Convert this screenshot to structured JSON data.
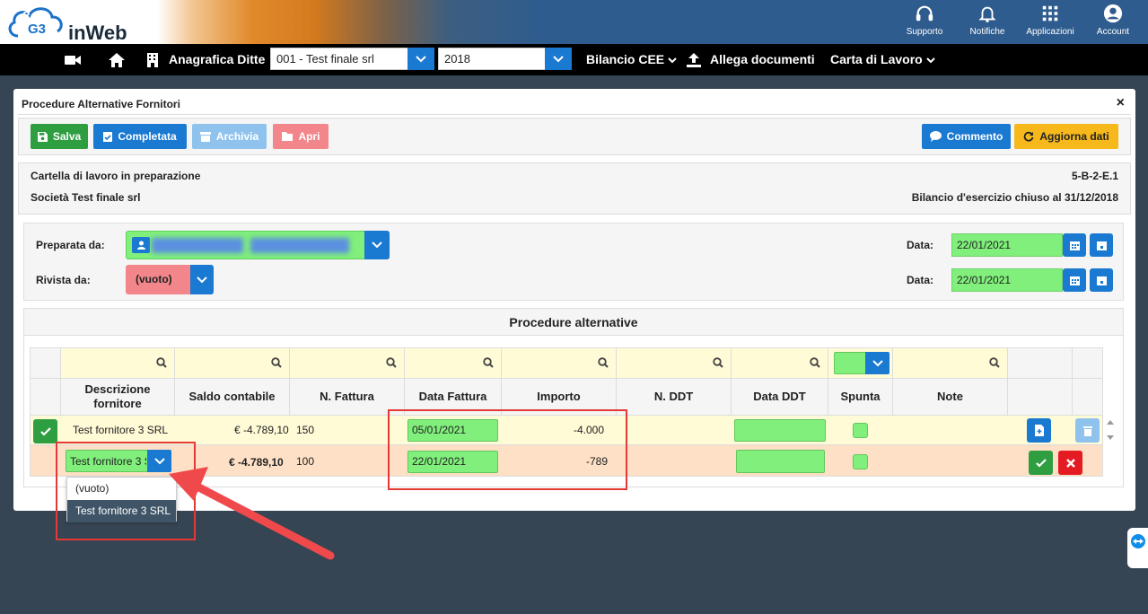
{
  "brand": {
    "name": "inWeb",
    "logo": "G3"
  },
  "topbar": {
    "items": [
      {
        "label": "Supporto",
        "icon": "headset-icon"
      },
      {
        "label": "Notifiche",
        "icon": "bell-icon"
      },
      {
        "label": "Applicazioni",
        "icon": "grid-icon"
      },
      {
        "label": "Account",
        "icon": "user-circle-icon"
      }
    ]
  },
  "navbar": {
    "help": "?",
    "anagrafica": "Anagrafica Ditte",
    "company_select": "001 - Test finale srl",
    "year_select": "2018",
    "bilancio": "Bilancio CEE",
    "allega": "Allega documenti",
    "carta": "Carta di Lavoro"
  },
  "modal": {
    "title": "Procedure Alternative Fornitori",
    "close": "×"
  },
  "toolbar": {
    "salva": "Salva",
    "completata": "Completata",
    "archivia": "Archivia",
    "apri": "Apri",
    "commento": "Commento",
    "aggiorna": "Aggiorna dati"
  },
  "info": {
    "status": "Cartella di lavoro in preparazione",
    "code": "5-B-2-E.1",
    "company": "Società Test finale srl",
    "bilancio": "Bilancio d'esercizio chiuso al 31/12/2018"
  },
  "form": {
    "preparata_label": "Preparata da:",
    "rivista_label": "Rivista da:",
    "rivista_value": "(vuoto)",
    "data_label": "Data:",
    "data1": "22/01/2021",
    "data2": "22/01/2021"
  },
  "section_title": "Procedure alternative",
  "table": {
    "headers": [
      "Descrizione fornitore",
      "Saldo contabile",
      "N. Fattura",
      "Data Fattura",
      "Importo",
      "N. DDT",
      "Data DDT",
      "Spunta",
      "Note"
    ],
    "rows": [
      {
        "fornitore": "Test fornitore 3 SRL",
        "saldo": "€ -4.789,10",
        "fattura": "150",
        "data_fattura": "05/01/2021",
        "importo": "-4.000"
      },
      {
        "fornitore": "Test fornitore 3 SRL",
        "saldo": "€ -4.789,10",
        "fattura": "100",
        "data_fattura": "22/01/2021",
        "importo": "-789"
      }
    ]
  },
  "dropdown": {
    "options": [
      "(vuoto)",
      "Test fornitore 3 SRL"
    ]
  },
  "colors": {
    "primary": "#1a79d1",
    "success": "#2e9e41",
    "danger": "#e41b23",
    "warning": "#f6b81a",
    "field_green": "#80ef7b",
    "row_edit": "#fde0c5",
    "row_header": "#fffbd6"
  }
}
